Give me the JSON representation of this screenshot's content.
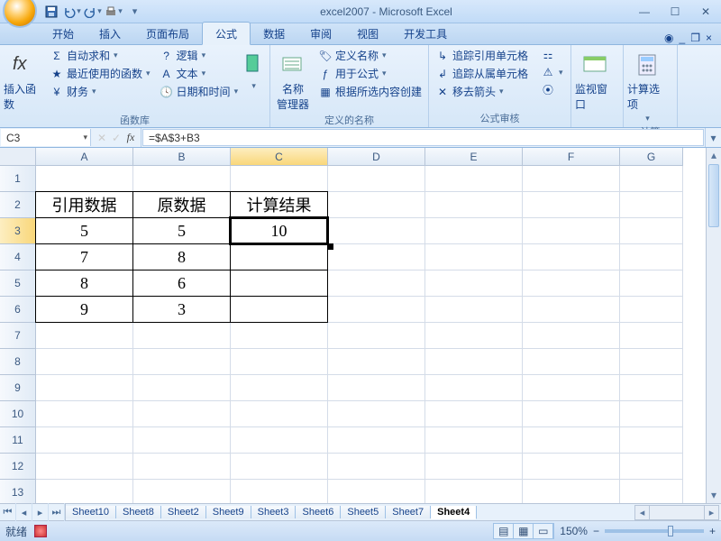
{
  "window": {
    "title": "excel2007 - Microsoft Excel"
  },
  "qat": {
    "save": "💾",
    "undo": "↶",
    "redo": "↷",
    "print": "🖶"
  },
  "tabs": {
    "items": [
      "开始",
      "插入",
      "页面布局",
      "公式",
      "数据",
      "审阅",
      "视图",
      "开发工具"
    ],
    "active_index": 3
  },
  "ribbon": {
    "group0": {
      "label": "函数库",
      "insert_fn_label": "插入函数",
      "autosum": "自动求和",
      "recent": "最近使用的函数",
      "finance": "财务",
      "logic": "逻辑",
      "text": "文本",
      "datetime": "日期和时间"
    },
    "group1": {
      "label": "定义的名称",
      "name_mgr": "名称\n管理器",
      "define_name": "定义名称",
      "use_in_formula": "用于公式",
      "create_from_sel": "根据所选内容创建"
    },
    "group2": {
      "label": "公式审核",
      "trace_prec": "追踪引用单元格",
      "trace_dep": "追踪从属单元格",
      "remove_arrows": "移去箭头"
    },
    "group3": {
      "label": "",
      "watch": "监视窗口"
    },
    "group4": {
      "label": "计算",
      "calc_opts": "计算选项"
    }
  },
  "formula_bar": {
    "cellref": "C3",
    "fx_label": "fx",
    "formula": "=$A$3+B3"
  },
  "sheet": {
    "columns": [
      "A",
      "B",
      "C",
      "D",
      "E",
      "F",
      "G"
    ],
    "sel_col_index": 2,
    "rows": [
      "1",
      "2",
      "3",
      "4",
      "5",
      "6",
      "7",
      "8",
      "9",
      "10",
      "11",
      "12",
      "13"
    ],
    "sel_row_index": 2,
    "data": {
      "header": [
        "引用数据",
        "原数据",
        "计算结果"
      ],
      "rows": [
        [
          "5",
          "5",
          "10"
        ],
        [
          "7",
          "8",
          ""
        ],
        [
          "8",
          "6",
          ""
        ],
        [
          "9",
          "3",
          ""
        ]
      ]
    }
  },
  "sheet_tabs": {
    "items": [
      "Sheet10",
      "Sheet8",
      "Sheet2",
      "Sheet9",
      "Sheet3",
      "Sheet6",
      "Sheet5",
      "Sheet7",
      "Sheet4"
    ],
    "active_index": 8
  },
  "status": {
    "ready": "就绪",
    "zoom": "150%"
  },
  "chart_data": null
}
